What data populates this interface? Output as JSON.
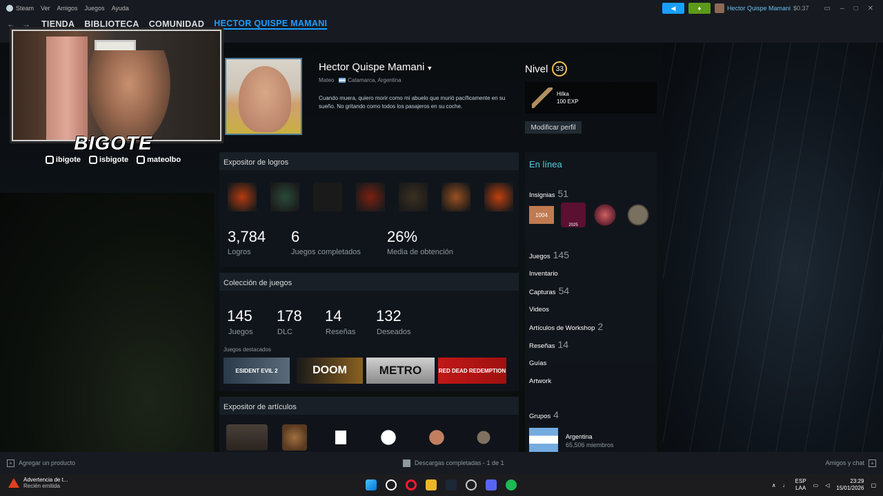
{
  "menubar": {
    "items": [
      "Steam",
      "Ver",
      "Amigos",
      "Juegos",
      "Ayuda"
    ]
  },
  "account": {
    "name": "Hector Quispe Mamani",
    "balance": "$0.37"
  },
  "nav": {
    "tabs": [
      "TIENDA",
      "BIBLIOTECA",
      "COMUNIDAD",
      "HECTOR QUISPE MAMANI"
    ]
  },
  "overlay": {
    "brand": "BIGOTE",
    "socials": [
      "ibigote",
      "isbigote",
      "mateolbo"
    ]
  },
  "profile": {
    "name": "Hector Quispe Mamani",
    "realname": "Mateo",
    "location": "Catamarca, Argentina",
    "summary": "Cuando muera, quiero morir como mi abuelo que murió pacíficamente en su sueño. No gritando como todos los pasajeros en su coche.",
    "level_label": "Nivel",
    "level": "33",
    "featured_badge": {
      "name": "Hilka",
      "xp": "100 EXP"
    },
    "edit_label": "Modificar perfil"
  },
  "achievements": {
    "title": "Expositor de logros",
    "total": "3,784",
    "total_label": "Logros",
    "completed": "6",
    "completed_label": "Juegos completados",
    "rate": "26%",
    "rate_label": "Media de obtención",
    "icons": [
      "#b43a10",
      "#2a4a3a",
      "#1a1a1a",
      "#7a2010",
      "#3a3020",
      "#9a5020",
      "#c04010"
    ]
  },
  "games": {
    "title": "Colección de juegos",
    "games": "145",
    "games_label": "Juegos",
    "dlc": "178",
    "dlc_label": "DLC",
    "reviews": "14",
    "reviews_label": "Reseñas",
    "wishlist": "132",
    "wishlist_label": "Deseados",
    "featured_label": "Juegos destacados",
    "featured": [
      "ESIDENT EVIL 2",
      "DOOM",
      "METRO",
      "RED DEAD REDEMPTION"
    ]
  },
  "items": {
    "title": "Expositor de artículos"
  },
  "sidebar": {
    "status": "En línea",
    "badges_label": "Insignias",
    "badges_count": "51",
    "badge_texts": [
      "1004",
      "2025"
    ],
    "games_label": "Juegos",
    "games_count": "145",
    "inventory_label": "Inventario",
    "screenshots_label": "Capturas",
    "screenshots_count": "54",
    "videos_label": "Videos",
    "workshop_label": "Artículos de Workshop",
    "workshop_count": "2",
    "reviews_label": "Reseñas",
    "reviews_count": "14",
    "guides_label": "Guías",
    "artwork_label": "Artwork",
    "groups_label": "Grupos",
    "groups_count": "4",
    "group_name": "Argentina",
    "group_members": "65,506 miembros"
  },
  "statusbar": {
    "add_product": "Agregar un producto",
    "downloads": "Descargas completadas - 1 de 1",
    "friends": "Amigos y chat"
  },
  "taskbar": {
    "notif_title": "Advertencia de t...",
    "notif_sub": "Recién emitida",
    "lang1": "ESP",
    "lang2": "LAA",
    "time": "23:29",
    "date": "15/01/2026"
  }
}
